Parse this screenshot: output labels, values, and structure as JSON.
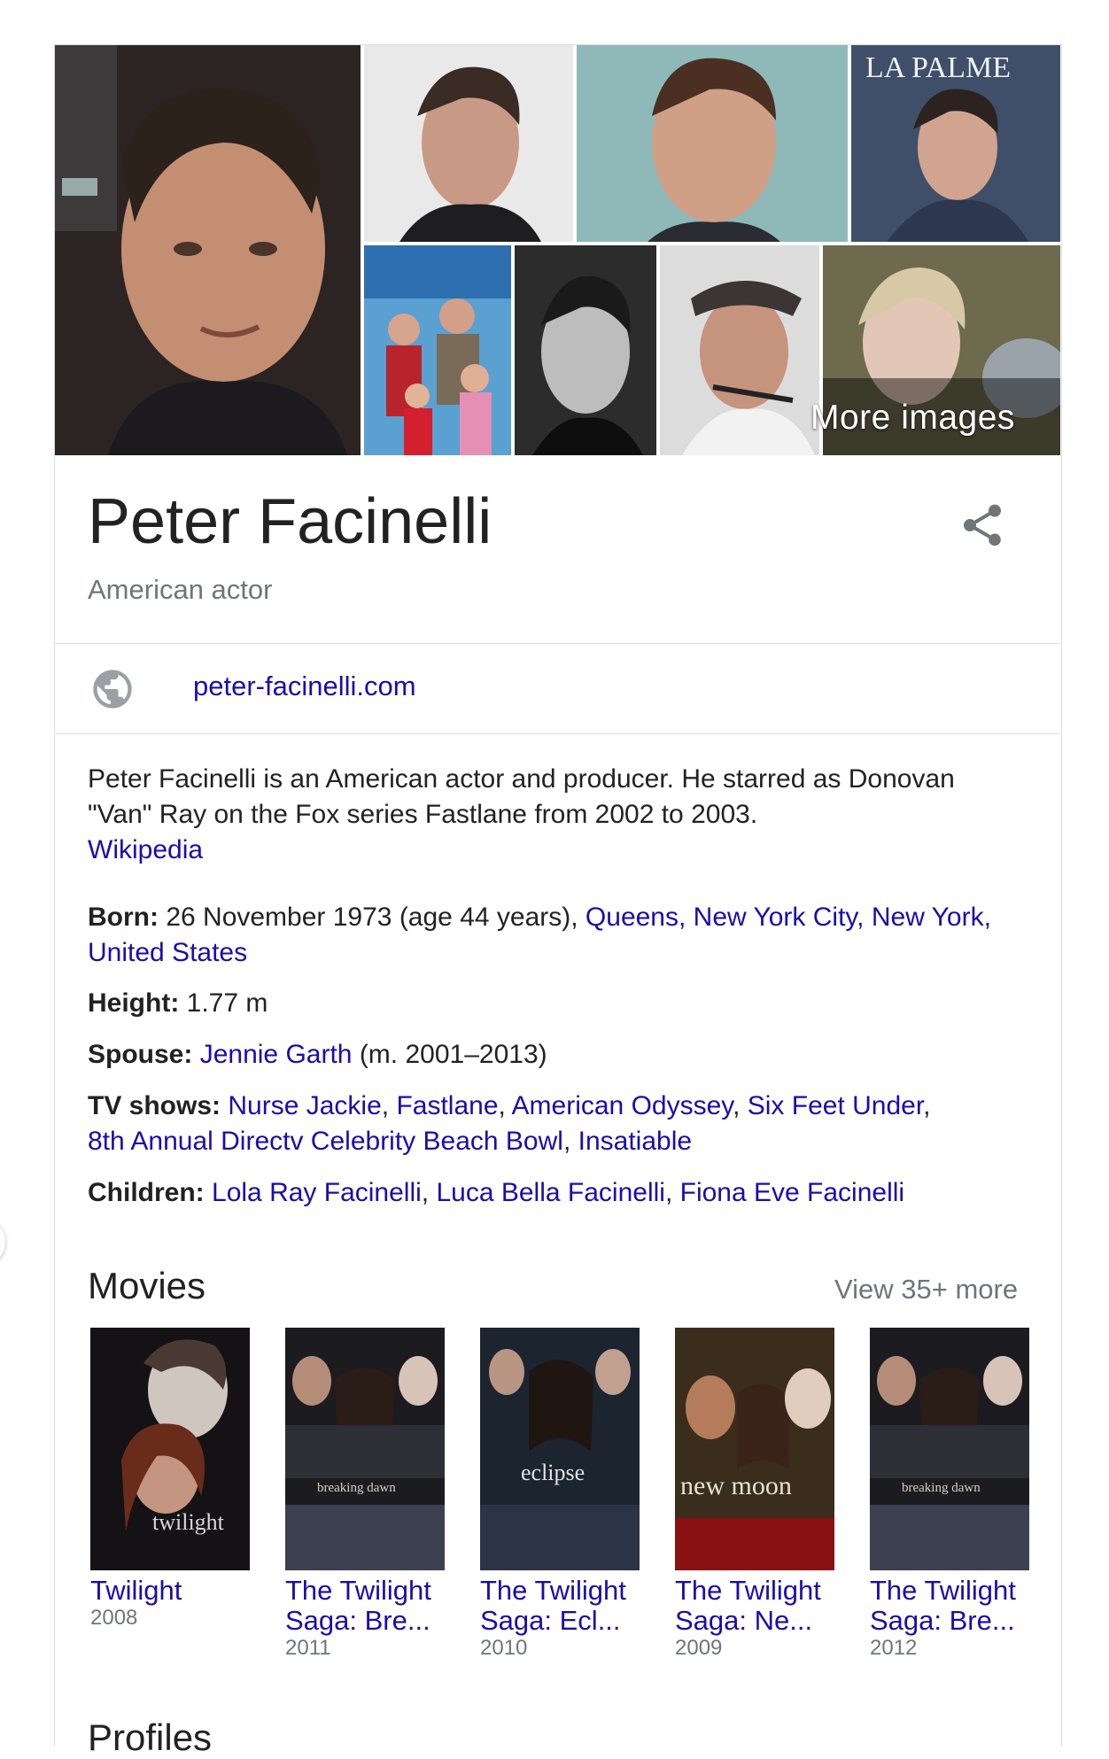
{
  "more_images_label": "More images",
  "title": "Peter Facinelli",
  "subtitle": "American actor",
  "website": "peter-facinelli.com",
  "description": {
    "text": "Peter Facinelli is an American actor and producer. He starred as Donovan \"Van\" Ray on the Fox series Fastlane from 2002 to 2003.",
    "source": "Wikipedia"
  },
  "facts": {
    "born": {
      "label": "Born:",
      "value": " 26 November 1973 (age 44 years), ",
      "place": "Queens, New York City, New York, United States"
    },
    "height": {
      "label": "Height:",
      "value": " 1.77 m"
    },
    "spouse": {
      "label": "Spouse:",
      "name": "Jennie Garth",
      "suffix": " (m. 2001–2013)"
    },
    "tv_shows": {
      "label": "TV shows:",
      "items": [
        "Nurse Jackie",
        "Fastlane",
        "American Odyssey",
        "Six Feet Under",
        "8th Annual Directv Celebrity Beach Bowl",
        "Insatiable"
      ],
      "sep": ", "
    },
    "children": {
      "label": "Children:",
      "items": [
        "Lola Ray Facinelli",
        "Luca Bella Facinelli",
        "Fiona Eve Facinelli"
      ],
      "sep": ", "
    }
  },
  "movies": {
    "heading": "Movies",
    "view_more": "View 35+ more",
    "items": [
      {
        "title": "Twilight",
        "title2": "",
        "year": "2008",
        "poster_word": "twilight"
      },
      {
        "title": "The Twilight",
        "title2": "Saga: Bre...",
        "year": "2011",
        "poster_word": "breaking dawn"
      },
      {
        "title": "The Twilight",
        "title2": "Saga: Ecl...",
        "year": "2010",
        "poster_word": "eclipse"
      },
      {
        "title": "The Twilight",
        "title2": "Saga: Ne...",
        "year": "2009",
        "poster_word": "new moon"
      },
      {
        "title": "The Twilight",
        "title2": "Saga: Bre...",
        "year": "2012",
        "poster_word": "breaking dawn"
      }
    ]
  },
  "magazine_logo": "LA PALME",
  "profiles_heading": "Profiles",
  "colors": {
    "link": "#1a0dab",
    "muted": "#70757a",
    "text": "#222222",
    "border": "#dadce0"
  }
}
